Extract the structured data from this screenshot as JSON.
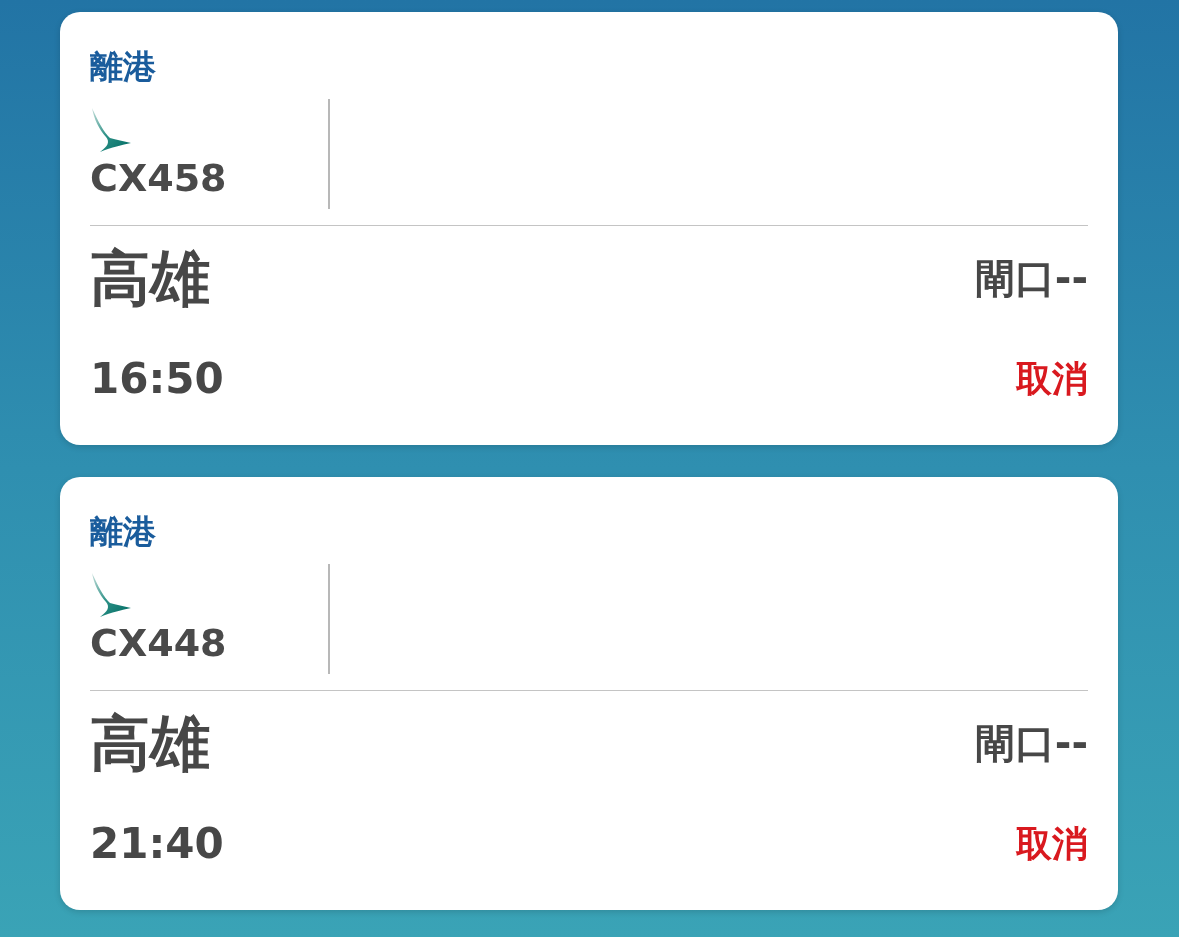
{
  "flights": [
    {
      "direction": "離港",
      "flight_number": "CX458",
      "destination": "高雄",
      "gate": "閘口--",
      "time": "16:50",
      "status": {
        "text": "取消",
        "kind": "cancelled"
      }
    },
    {
      "direction": "離港",
      "flight_number": "CX448",
      "destination": "高雄",
      "gate": "閘口--",
      "time": "21:40",
      "status": {
        "text": "取消",
        "kind": "cancelled"
      }
    }
  ]
}
